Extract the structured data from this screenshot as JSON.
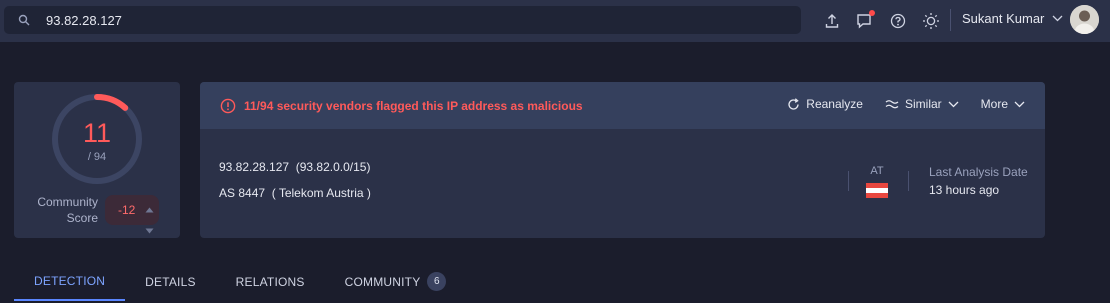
{
  "search": {
    "value": "93.82.28.127"
  },
  "user": {
    "name": "Sukant Kumar"
  },
  "score": {
    "detections": "11",
    "total": "/ 94",
    "ratio": 0.117
  },
  "community": {
    "label_line1": "Community",
    "label_line2": "Score",
    "value": "-12"
  },
  "alert": {
    "text": "11/94 security vendors flagged this IP address as malicious"
  },
  "actions": {
    "reanalyze": "Reanalyze",
    "similar": "Similar",
    "more": "More"
  },
  "ip": {
    "address": "93.82.28.127",
    "network": "(93.82.0.0/15)",
    "asn": "AS 8447",
    "owner": "( Telekom Austria )"
  },
  "country": {
    "code": "AT"
  },
  "analysis": {
    "label": "Last Analysis Date",
    "value": "13 hours ago"
  },
  "tabs": [
    {
      "label": "DETECTION"
    },
    {
      "label": "DETAILS"
    },
    {
      "label": "RELATIONS"
    },
    {
      "label": "COMMUNITY",
      "count": "6"
    }
  ],
  "colors": {
    "accent": "#5a86ff",
    "danger": "#ff5a5a",
    "flag_red": "#e8473f"
  }
}
